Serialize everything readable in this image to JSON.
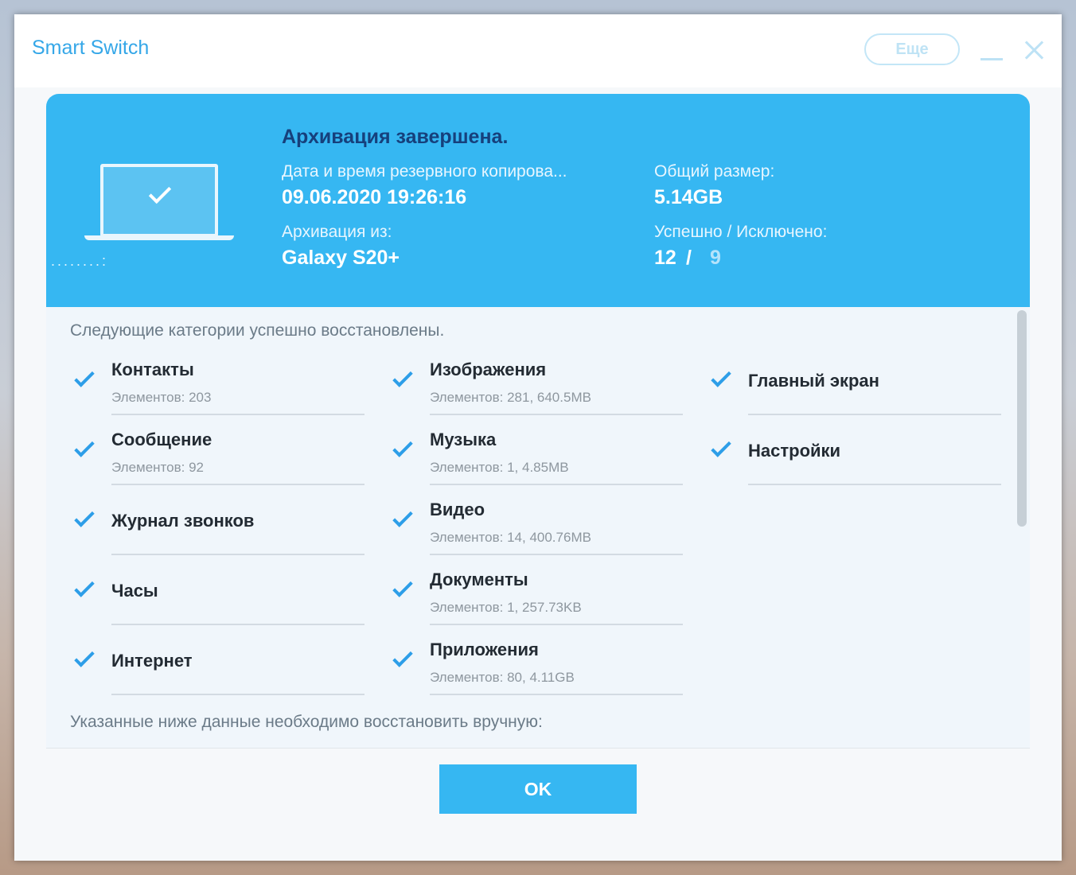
{
  "app": {
    "title": "Smart Switch",
    "more_label": "Еще"
  },
  "banner": {
    "title": "Архивация завершена.",
    "date_label": "Дата и время резервного копирова...",
    "date_value": "09.06.2020 19:26:16",
    "source_label": "Архивация из:",
    "source_value": "Galaxy S20+",
    "size_label": "Общий размер:",
    "size_value": "5.14GB",
    "status_label": "Успешно / Исключено:",
    "status_success": "12",
    "status_sep": "/",
    "status_excluded": "9",
    "dots": "........:"
  },
  "content": {
    "restored_title": "Следующие категории успешно восстановлены.",
    "manual_title": "Указанные ниже данные необходимо восстановить вручную:",
    "items": [
      {
        "name": "Контакты",
        "sub": "Элементов: 203"
      },
      {
        "name": "Сообщение",
        "sub": "Элементов: 92"
      },
      {
        "name": "Журнал звонков",
        "sub": ""
      },
      {
        "name": "Часы",
        "sub": ""
      },
      {
        "name": "Интернет",
        "sub": ""
      },
      {
        "name": "Изображения",
        "sub": "Элементов: 281, 640.5MB"
      },
      {
        "name": "Музыка",
        "sub": "Элементов: 1, 4.85MB"
      },
      {
        "name": "Видео",
        "sub": "Элементов: 14, 400.76MB"
      },
      {
        "name": "Документы",
        "sub": "Элементов: 1, 257.73KB"
      },
      {
        "name": "Приложения",
        "sub": "Элементов: 80, 4.11GB"
      },
      {
        "name": "Главный экран",
        "sub": ""
      },
      {
        "name": "Настройки",
        "sub": ""
      }
    ]
  },
  "footer": {
    "ok_label": "OK"
  }
}
